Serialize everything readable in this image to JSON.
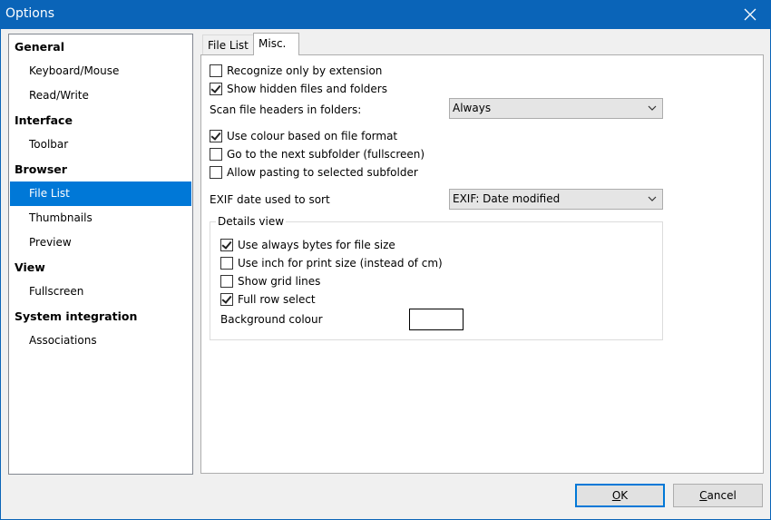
{
  "window": {
    "title": "Options"
  },
  "nav": {
    "items": [
      {
        "label": "General",
        "type": "category"
      },
      {
        "label": "Keyboard/Mouse",
        "type": "sub"
      },
      {
        "label": "Read/Write",
        "type": "sub"
      },
      {
        "label": "Interface",
        "type": "category"
      },
      {
        "label": "Toolbar",
        "type": "sub"
      },
      {
        "label": "Browser",
        "type": "category"
      },
      {
        "label": "File List",
        "type": "sub",
        "selected": true
      },
      {
        "label": "Thumbnails",
        "type": "sub"
      },
      {
        "label": "Preview",
        "type": "sub"
      },
      {
        "label": "View",
        "type": "category"
      },
      {
        "label": "Fullscreen",
        "type": "sub"
      },
      {
        "label": "System integration",
        "type": "category"
      },
      {
        "label": "Associations",
        "type": "sub"
      }
    ]
  },
  "tabs": [
    {
      "label": "File List",
      "active": false
    },
    {
      "label": "Misc.",
      "active": true
    }
  ],
  "options": {
    "recognize_ext": {
      "label": "Recognize only by extension",
      "checked": false
    },
    "show_hidden": {
      "label": "Show hidden files and folders",
      "checked": true
    },
    "scan_headers": {
      "label": "Scan file headers in folders:",
      "value": "Always"
    },
    "use_colour": {
      "label": "Use colour based on file format",
      "checked": true
    },
    "next_subfolder": {
      "label": "Go to the next subfolder (fullscreen)",
      "checked": false
    },
    "allow_pasting": {
      "label": "Allow pasting to selected subfolder",
      "checked": false
    },
    "exif_sort": {
      "label": "EXIF date used to sort",
      "value": "EXIF: Date modified"
    }
  },
  "details_view": {
    "legend": "Details view",
    "bytes": {
      "label": "Use always bytes for file size",
      "checked": true
    },
    "inch": {
      "label": "Use inch for print size (instead of cm)",
      "checked": false
    },
    "grid": {
      "label": "Show grid lines",
      "checked": false
    },
    "full_row": {
      "label": "Full row select",
      "checked": true
    },
    "bg_colour": {
      "label": "Background colour",
      "color": "#ffffff"
    }
  },
  "buttons": {
    "ok": {
      "mnemonic": "O",
      "rest": "K"
    },
    "cancel": {
      "mnemonic": "C",
      "rest": "ancel"
    }
  },
  "colors": {
    "titlebar": "#0a64b8",
    "selection": "#0078d7"
  }
}
